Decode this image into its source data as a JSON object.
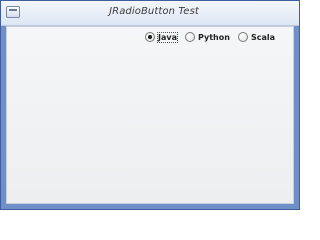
{
  "window": {
    "title": "JRadioButton Test"
  },
  "radio_group": {
    "options": [
      {
        "label": "Java",
        "selected": true
      },
      {
        "label": "Python",
        "selected": false
      },
      {
        "label": "Scala",
        "selected": false
      }
    ]
  },
  "colors": {
    "frame_border": "#6f8fc9",
    "content_background": "#eceeef",
    "title_text": "#3d3d3d"
  }
}
